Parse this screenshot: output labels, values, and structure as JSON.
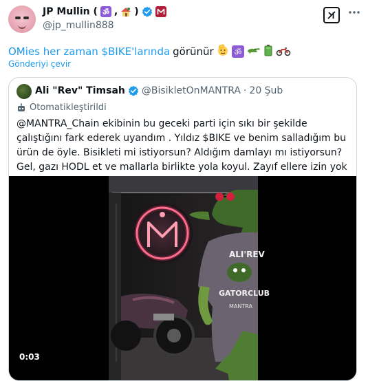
{
  "author": {
    "name": "JP Mullin (",
    "name_sep": ",",
    "name_close": ")",
    "handle": "@jp_mullin888",
    "accent_color": "#1d9bf0"
  },
  "actions": {
    "grok_icon": "grok-icon",
    "more_icon": "more-icon"
  },
  "tweet": {
    "link_text": "OMies her zaman $BIKE'larında",
    "rest_text": "görünür",
    "translate_label": "Gönderiyi çevir"
  },
  "quote": {
    "name": "Ali \"Rev\" Timsah",
    "handle": "@BisikletOnMANTRA",
    "dot": "·",
    "date": "20 Şub",
    "automated_label": "Otomatikleştirildi",
    "body": "@MANTRA_Chain ekibinin bu geceki parti için sıkı bir şekilde çalıştığını fark ederek uyandım . Yıldız $BIKE ve benim salladığım bu ürün de öyle. Bisikleti mi istiyorsun? Aldığım damlayı mı istiyorsun? Gel, gazı HODL et ve mallarla birlikte yola koyul. Zayıf ellere izin yok",
    "video_time": "0:03",
    "shirt_line1": "ALI'REV",
    "shirt_line2": "GATORCLUB",
    "shirt_line3": "MANTRA"
  }
}
